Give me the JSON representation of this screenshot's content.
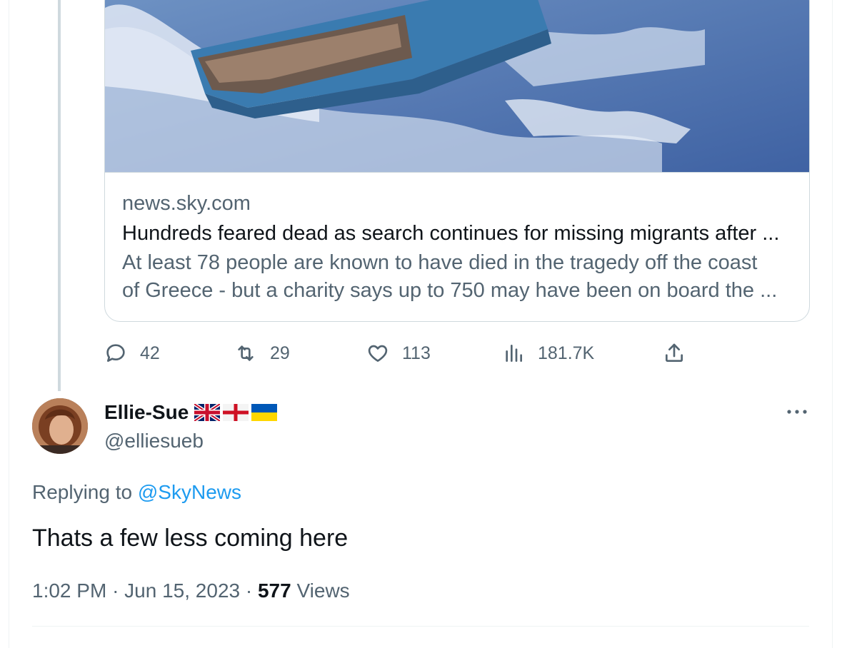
{
  "link_card": {
    "domain": "news.sky.com",
    "title": "Hundreds feared dead as search continues for missing migrants after ...",
    "description_line1": "At least 78 people are known to have died in the tragedy off the coast",
    "description_line2": "of Greece - but a charity says up to 750 may have been on board the ..."
  },
  "actions": {
    "replies": "42",
    "retweets": "29",
    "likes": "113",
    "views": "181.7K"
  },
  "reply": {
    "display_name": "Ellie-Sue",
    "flags": [
      "uk-flag-icon",
      "england-flag-icon",
      "ukraine-flag-icon"
    ],
    "handle": "@elliesueb",
    "replying_prefix": "Replying to",
    "replying_mention": "@SkyNews",
    "text": "Thats a few less coming here",
    "time": "1:02 PM",
    "date": "Jun 15, 2023",
    "views_count": "577",
    "views_label": "Views"
  },
  "colors": {
    "text_primary": "#0f1419",
    "text_secondary": "#536471",
    "link": "#1d9bf0",
    "border": "#cfd9de"
  }
}
